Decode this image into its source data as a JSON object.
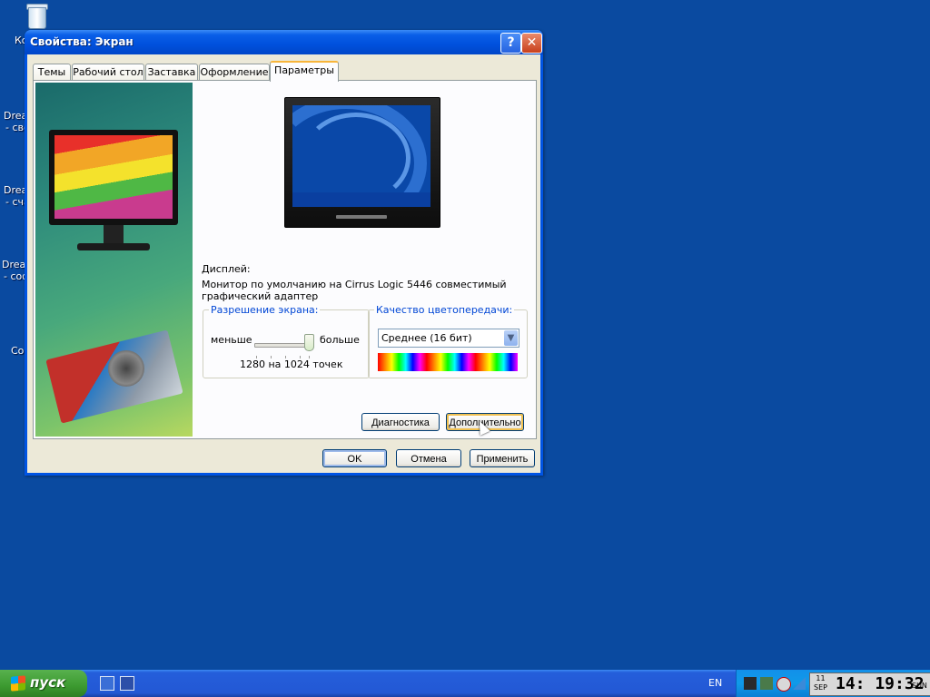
{
  "desktop": {
    "icons": [
      {
        "label": "Ко"
      },
      {
        "label": "Dreа"
      },
      {
        "label": "- сво"
      },
      {
        "label": "Dreа"
      },
      {
        "label": "- сча"
      },
      {
        "label": "Dreа"
      },
      {
        "label": "- соф"
      },
      {
        "label": "Co"
      }
    ]
  },
  "window": {
    "title": "Свойства: Экран",
    "help_label": "?",
    "close_label": "✕",
    "tabs": [
      {
        "label": "Темы"
      },
      {
        "label": "Рабочий стол"
      },
      {
        "label": "Заставка"
      },
      {
        "label": "Оформление"
      },
      {
        "label": "Параметры"
      }
    ],
    "active_tab": "Параметры",
    "display_label": "Дисплей:",
    "display_line1": "Монитор по умолчанию на Cirrus Logic 5446 совместимый",
    "display_line2": "графический адаптер",
    "resolution": {
      "legend": "Разрешение экрана:",
      "less": "меньше",
      "more": "больше",
      "value": "1280 на 1024 точек",
      "slider_position": 1.0
    },
    "color": {
      "legend": "Качество цветопередачи:",
      "selected": "Среднее (16 бит)",
      "dropdown_icon": "chevron-down-icon"
    },
    "buttons": {
      "diagnostics": "Диагностика",
      "advanced": "Дополнительно",
      "ok": "OK",
      "cancel": "Отмена",
      "apply": "Применить"
    }
  },
  "taskbar": {
    "start_label": "пуск",
    "language": "EN",
    "clock": {
      "day": "11",
      "month": "SEP",
      "time": "14: 19:32",
      "weekday": "SUN"
    }
  }
}
